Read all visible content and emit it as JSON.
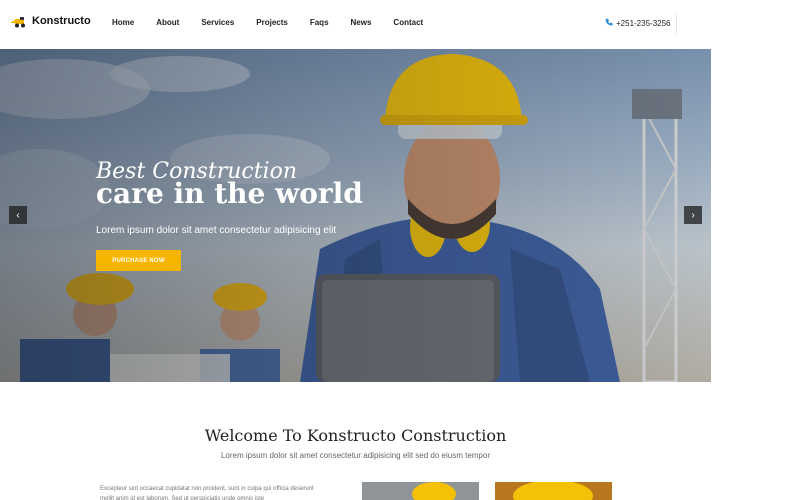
{
  "header": {
    "logo_text": "Konstructo",
    "nav": [
      "Home",
      "About",
      "Services",
      "Projects",
      "Faqs",
      "News",
      "Contact"
    ],
    "phone": "+251-235-3256"
  },
  "hero": {
    "kicker": "Best Construction",
    "title": "care in the world",
    "subtitle": "Lorem ipsum dolor sit amet consectetur adipisicing elit",
    "button_label": "PURCHASE NOW",
    "prev_icon": "‹",
    "next_icon": "›"
  },
  "welcome": {
    "title": "Welcome To Konstructo Construction",
    "subtitle": "Lorem ipsum dolor sit amet consectetur adipisicing elit sed do eiusm tempor",
    "body": "Excepteur sint occaecat cupidatat non proident, sunt in culpa qui officia deserunt mollit anim id est laborum. Sed ut perspiciatis unde omnis iste"
  },
  "colors": {
    "accent": "#f6b500",
    "phone_icon": "#2f8fd8"
  },
  "icons": {
    "logo": "construction-vehicle-icon",
    "phone": "phone-icon",
    "prev": "chevron-left-icon",
    "next": "chevron-right-icon"
  }
}
